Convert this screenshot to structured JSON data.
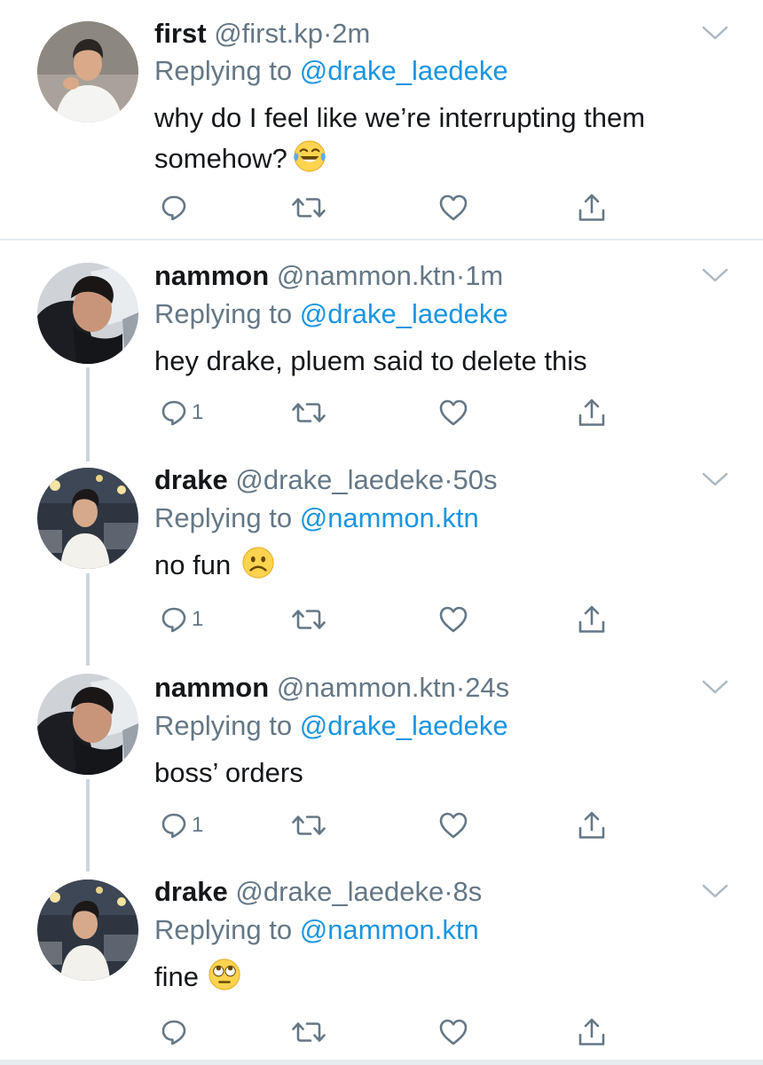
{
  "tweets": [
    {
      "name": "first",
      "handle": "@first.kp",
      "dot": "·",
      "time": "2m",
      "replying_prefix": "Replying to ",
      "replying_to": "@drake_laedeke",
      "text_line1": "why do I feel like we’re interrupting them",
      "text_line2": "somehow?",
      "emoji": "face-with-tears-of-joy",
      "reply_count": ""
    },
    {
      "name": "nammon",
      "handle": "@nammon.ktn",
      "dot": "·",
      "time": "1m",
      "replying_prefix": "Replying to ",
      "replying_to": "@drake_laedeke",
      "text_line1": "hey drake, pluem said to delete this",
      "reply_count": "1"
    },
    {
      "name": "drake",
      "handle": "@drake_laedeke",
      "dot": "·",
      "time": "50s",
      "replying_prefix": "Replying to ",
      "replying_to": "@nammon.ktn",
      "text_line1": "no fun",
      "emoji": "frowning-face",
      "reply_count": "1"
    },
    {
      "name": "nammon",
      "handle": "@nammon.ktn",
      "dot": "·",
      "time": "24s",
      "replying_prefix": "Replying to ",
      "replying_to": "@drake_laedeke",
      "text_line1": "boss’ orders",
      "reply_count": "1"
    },
    {
      "name": "drake",
      "handle": "@drake_laedeke",
      "dot": "·",
      "time": "8s",
      "replying_prefix": "Replying to ",
      "replying_to": "@nammon.ktn",
      "text_line1": "fine",
      "emoji": "face-with-rolling-eyes",
      "reply_count": ""
    }
  ],
  "colors": {
    "link": "#1b95e0",
    "secondary": "#657786",
    "thread_line": "#ccd6dd",
    "divider": "#e6ecf0"
  }
}
